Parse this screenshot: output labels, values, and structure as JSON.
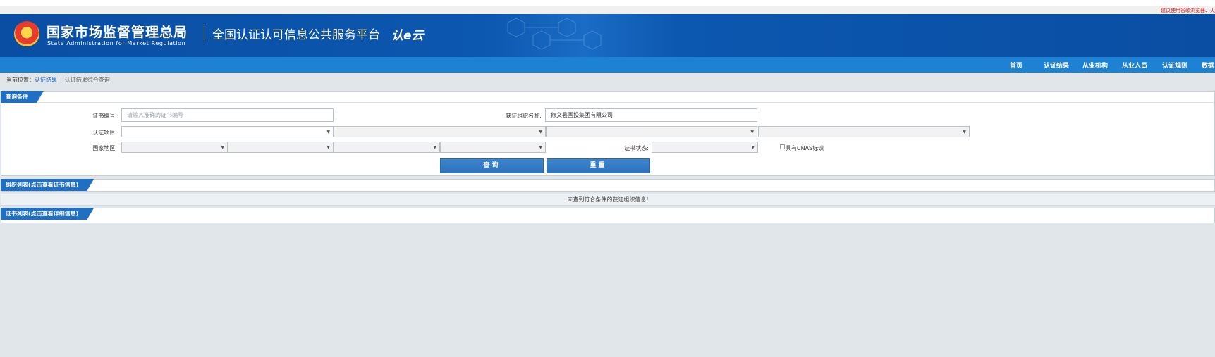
{
  "browser_notice": "建议使用谷歌浏览器、火",
  "header": {
    "org_cn": "国家市场监督管理总局",
    "org_en": "State Administration for Market Regulation",
    "platform": "全国认证认可信息公共服务平台",
    "logo_text": "认e云",
    "emblem_icon": "national-emblem-icon",
    "accent_color": "#0a4ea3"
  },
  "nav": [
    {
      "label": "首页"
    },
    {
      "label": "认证结果"
    },
    {
      "label": "从业机构"
    },
    {
      "label": "从业人员"
    },
    {
      "label": "认证规则"
    },
    {
      "label": "数据"
    }
  ],
  "breadcrumb": {
    "prefix": "当前位置：",
    "current": "认证结果",
    "separator": "|",
    "page": "认证结果综合查询"
  },
  "query": {
    "title": "查询条件",
    "cert_no_label": "证书编号:",
    "cert_no_placeholder": "请输入准确的证书编号",
    "org_name_label": "获证组织名称:",
    "org_name_value": "修文县国投集团有限公司",
    "project_label": "认证项目:",
    "region_label": "国家地区:",
    "status_label": "证书状态:",
    "cnas_label": "具有CNAS标识",
    "search_button": "查询",
    "reset_button": "重置"
  },
  "org_list": {
    "title": "组织列表(点击查看证书信息)",
    "empty_text": "未查到符合条件的获证组织信息!"
  },
  "cert_list": {
    "title": "证书列表(点击查看详细信息)"
  }
}
